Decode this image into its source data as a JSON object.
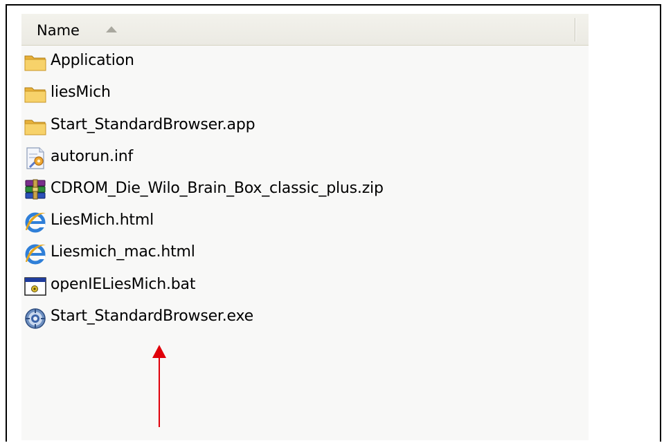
{
  "header": {
    "name_column": "Name"
  },
  "files": [
    {
      "label": "Application",
      "icon": "folder-icon"
    },
    {
      "label": "liesMich",
      "icon": "folder-icon"
    },
    {
      "label": "Start_StandardBrowser.app",
      "icon": "folder-icon"
    },
    {
      "label": "autorun.inf",
      "icon": "settings-file-icon"
    },
    {
      "label": "CDROM_Die_Wilo_Brain_Box_classic_plus.zip",
      "icon": "winrar-archive-icon"
    },
    {
      "label": "LiesMich.html",
      "icon": "internet-explorer-icon"
    },
    {
      "label": "Liesmich_mac.html",
      "icon": "internet-explorer-icon"
    },
    {
      "label": "openIELiesMich.bat",
      "icon": "batch-file-icon"
    },
    {
      "label": "Start_StandardBrowser.exe",
      "icon": "application-exe-icon"
    }
  ],
  "annotation": {
    "arrow_color": "#e0000a",
    "target": "Start_StandardBrowser.exe"
  },
  "colors": {
    "folder": "#f5c84c",
    "header_bg": "#ebeae3",
    "list_bg": "#f8f8f7"
  }
}
